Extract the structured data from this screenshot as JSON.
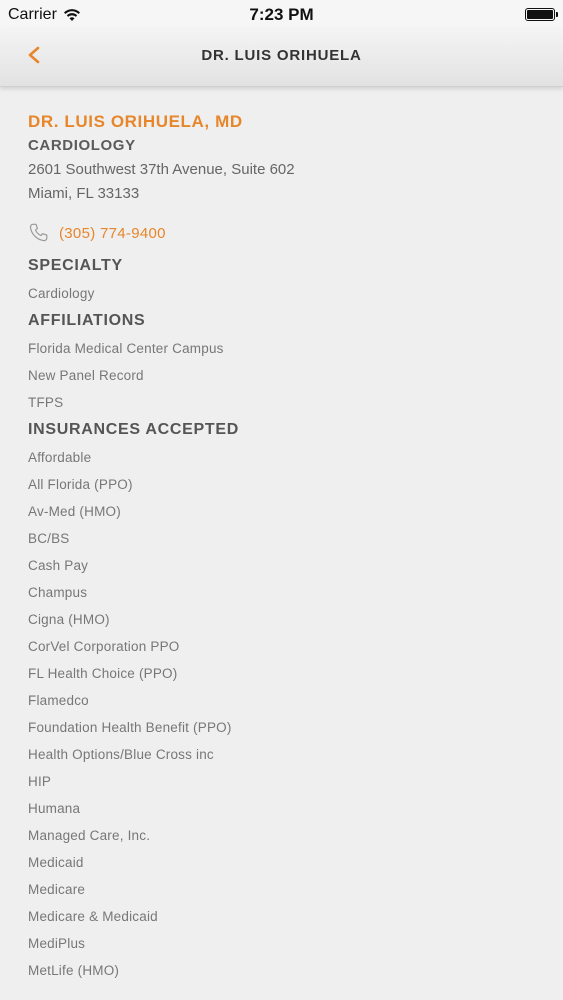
{
  "status_bar": {
    "carrier": "Carrier",
    "time": "7:23 PM"
  },
  "nav": {
    "title": "DR. LUIS ORIHUELA",
    "back_icon": "chevron-left-icon"
  },
  "doctor": {
    "name": "DR. LUIS ORIHUELA, MD",
    "specialty": "CARDIOLOGY",
    "address_line1": "2601 Southwest 37th Avenue, Suite 602",
    "address_line2": "Miami, FL 33133",
    "phone": "(305) 774-9400"
  },
  "sections": {
    "specialty": {
      "title": "SPECIALTY",
      "items": [
        "Cardiology"
      ]
    },
    "affiliations": {
      "title": "AFFILIATIONS",
      "items": [
        "Florida Medical Center Campus",
        "New Panel Record",
        "TFPS"
      ]
    },
    "insurances": {
      "title": "INSURANCES ACCEPTED",
      "items": [
        "Affordable",
        "All Florida (PPO)",
        "Av-Med (HMO)",
        "BC/BS",
        "Cash Pay",
        "Champus",
        "Cigna (HMO)",
        "CorVel Corporation PPO",
        "FL Health Choice (PPO)",
        "Flamedco",
        "Foundation Health Benefit (PPO)",
        "Health Options/Blue Cross inc",
        "HIP",
        "Humana",
        "Managed Care, Inc.",
        "Medicaid",
        "Medicare",
        "Medicare & Medicaid",
        "MediPlus",
        "MetLife (HMO)"
      ]
    }
  },
  "colors": {
    "accent": "#e7862a",
    "background": "#efefef",
    "heading": "#555555",
    "body_text": "#777777"
  }
}
